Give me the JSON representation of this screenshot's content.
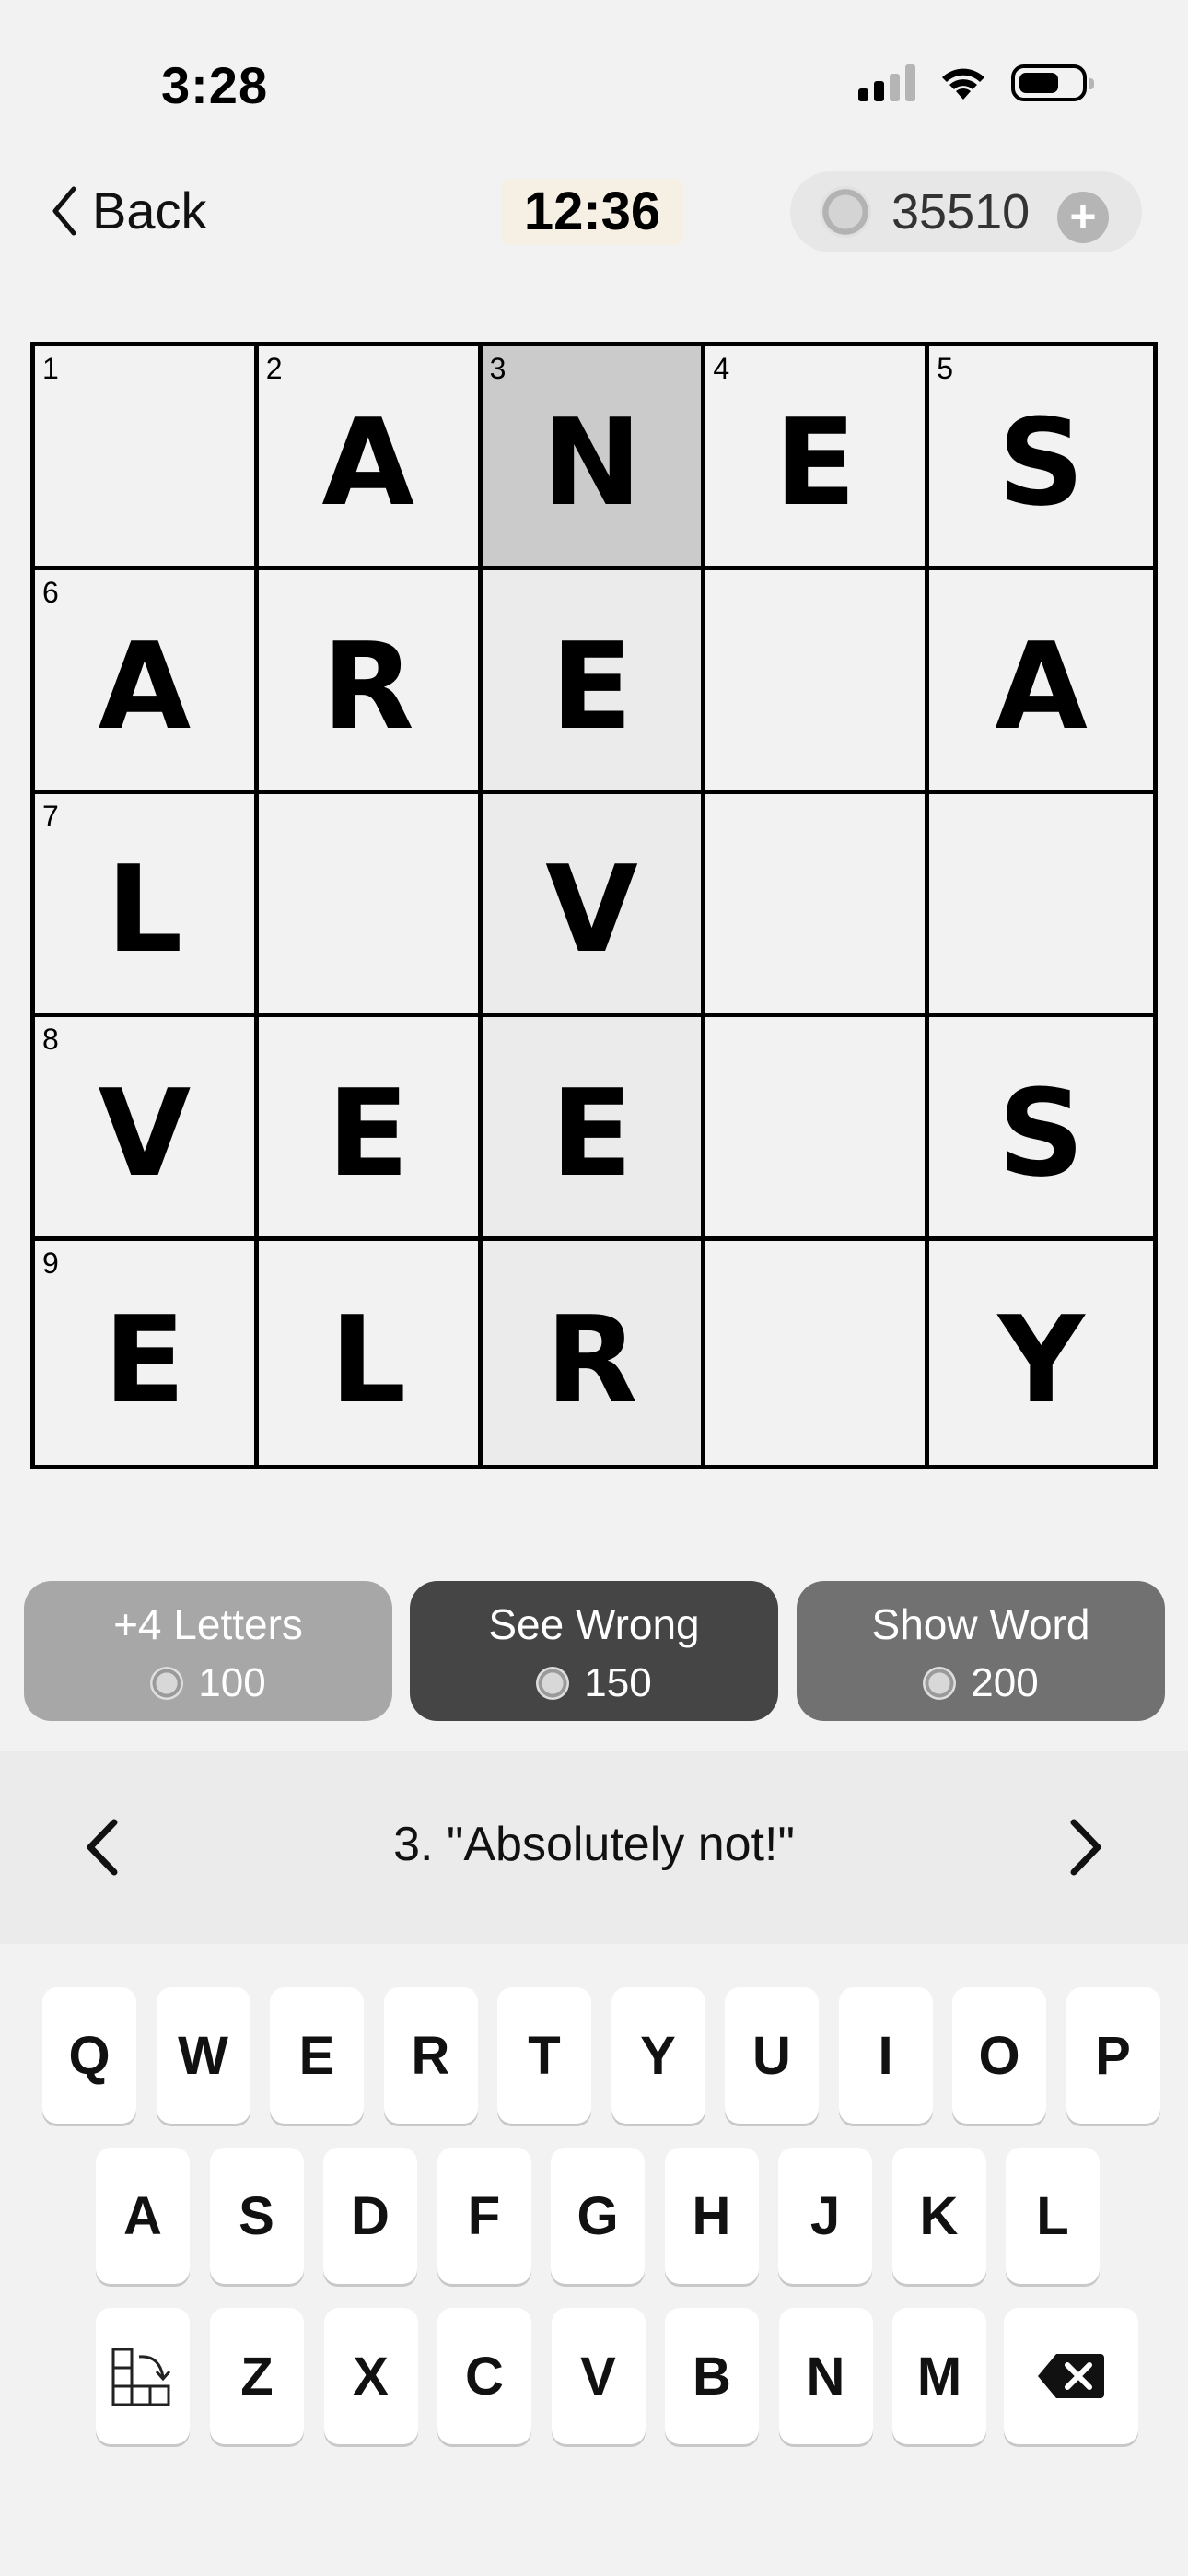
{
  "status_bar": {
    "time": "3:28"
  },
  "header": {
    "back_label": "Back",
    "timer": "12:36",
    "coins": "35510",
    "plus_symbol": "+"
  },
  "grid": {
    "rows": [
      [
        {
          "num": "1",
          "letter": ""
        },
        {
          "num": "2",
          "letter": "A"
        },
        {
          "num": "3",
          "letter": "N"
        },
        {
          "num": "4",
          "letter": "E"
        },
        {
          "num": "5",
          "letter": "S"
        }
      ],
      [
        {
          "num": "6",
          "letter": "A"
        },
        {
          "num": "",
          "letter": "R"
        },
        {
          "num": "",
          "letter": "E"
        },
        {
          "num": "",
          "letter": ""
        },
        {
          "num": "",
          "letter": "A"
        }
      ],
      [
        {
          "num": "7",
          "letter": "L"
        },
        {
          "num": "",
          "letter": ""
        },
        {
          "num": "",
          "letter": "V"
        },
        {
          "num": "",
          "letter": ""
        },
        {
          "num": "",
          "letter": ""
        }
      ],
      [
        {
          "num": "8",
          "letter": "V"
        },
        {
          "num": "",
          "letter": "E"
        },
        {
          "num": "",
          "letter": "E"
        },
        {
          "num": "",
          "letter": ""
        },
        {
          "num": "",
          "letter": "S"
        }
      ],
      [
        {
          "num": "9",
          "letter": "E"
        },
        {
          "num": "",
          "letter": "L"
        },
        {
          "num": "",
          "letter": "R"
        },
        {
          "num": "",
          "letter": ""
        },
        {
          "num": "",
          "letter": "Y"
        }
      ]
    ]
  },
  "hints": [
    {
      "label": "+4 Letters",
      "cost": "100"
    },
    {
      "label": "See Wrong",
      "cost": "150"
    },
    {
      "label": "Show Word",
      "cost": "200"
    }
  ],
  "clue": {
    "text": "3. \"Absolutely not!\""
  },
  "keyboard": {
    "row1": [
      "Q",
      "W",
      "E",
      "R",
      "T",
      "Y",
      "U",
      "I",
      "O",
      "P"
    ],
    "row2": [
      "A",
      "S",
      "D",
      "F",
      "G",
      "H",
      "J",
      "K",
      "L"
    ],
    "row3": [
      "Z",
      "X",
      "C",
      "V",
      "B",
      "N",
      "M"
    ]
  }
}
